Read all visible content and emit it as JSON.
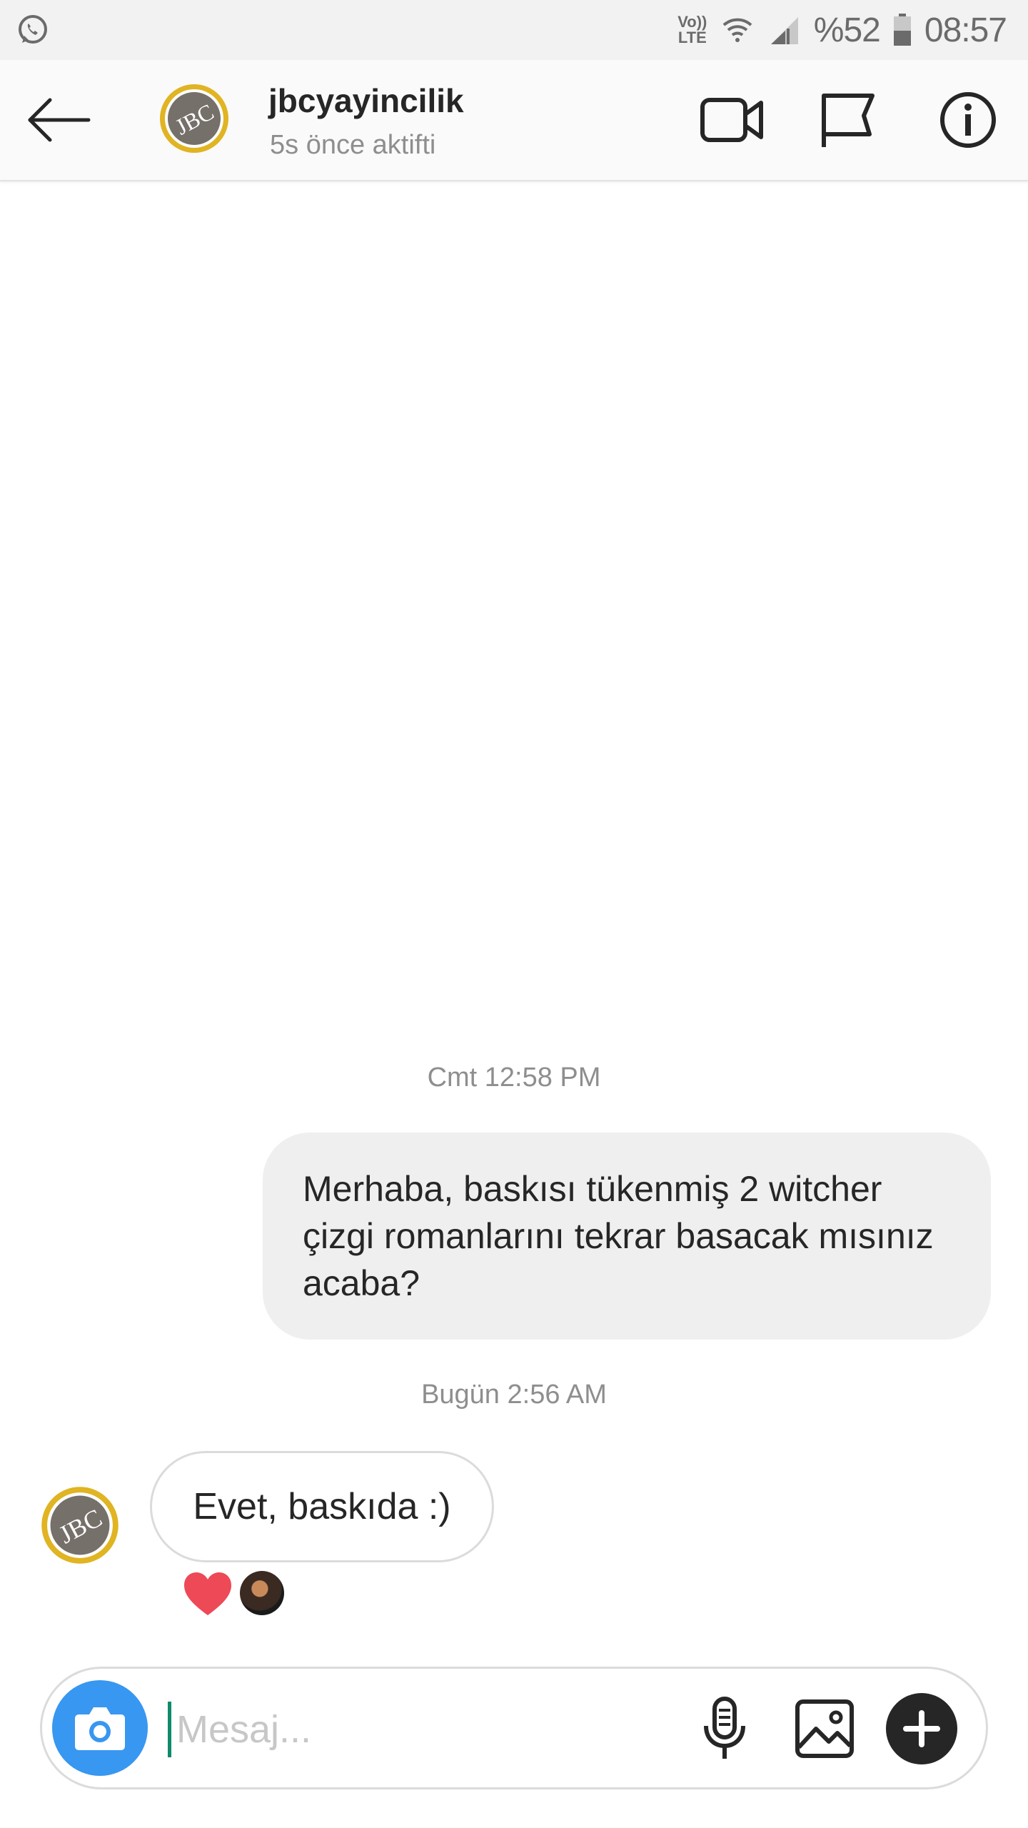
{
  "status_bar": {
    "network_label": "Vo)) LTE",
    "battery": "%52",
    "time": "08:57",
    "icons": [
      "whatsapp-icon",
      "wifi-icon",
      "signal-icon",
      "battery-icon"
    ]
  },
  "header": {
    "username": "jbcyayincilik",
    "status": "5s önce aktifti",
    "avatar_text": "JBC",
    "icons": [
      "back-arrow-icon",
      "video-call-icon",
      "flag-icon",
      "info-icon"
    ]
  },
  "conversation": {
    "timestamp_1": "Cmt 12:58 PM",
    "outgoing_message": "Merhaba, baskısı tükenmiş 2 witcher çizgi romanlarını tekrar basacak mısınız acaba?",
    "timestamp_2": "Bugün 2:56 AM",
    "incoming_message": "Evet, baskıda :)",
    "reaction": "heart-icon"
  },
  "composer": {
    "placeholder": "Mesaj...",
    "value": "",
    "icons": [
      "camera-icon",
      "microphone-icon",
      "gallery-icon",
      "plus-icon"
    ]
  },
  "colors": {
    "accent_blue": "#3897f0",
    "heart_red": "#ed4956",
    "avatar_gold": "#e0b422",
    "avatar_gray": "#76706a"
  }
}
